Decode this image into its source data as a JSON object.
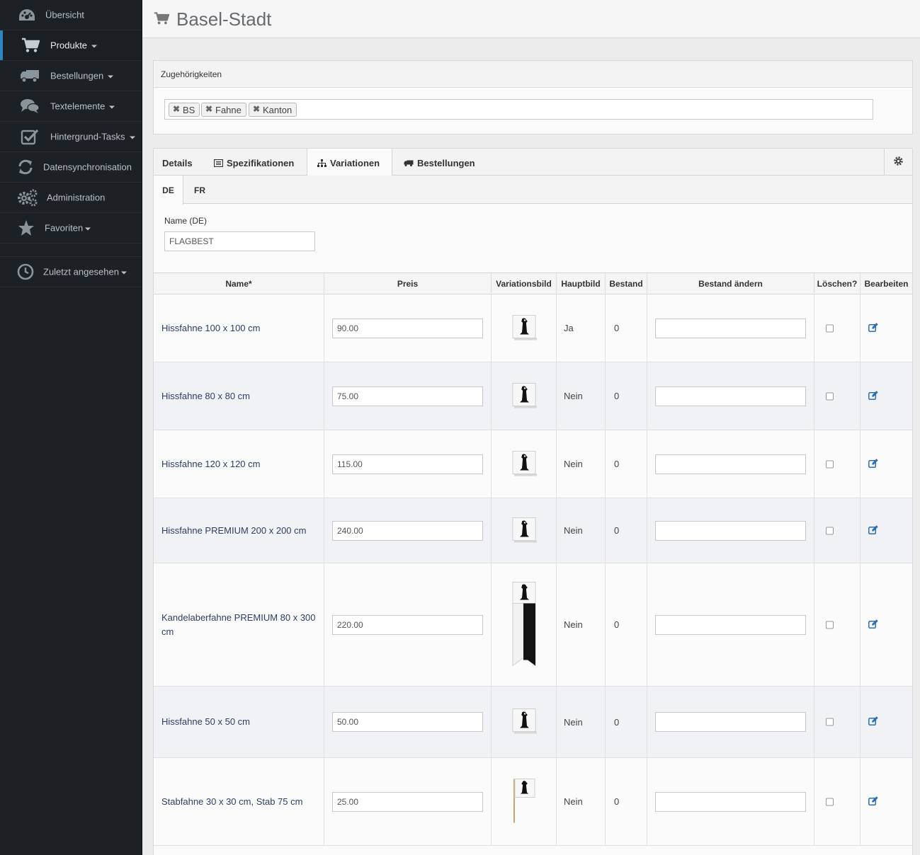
{
  "sidebar": {
    "items": [
      {
        "label": "Übersicht",
        "icon": "dashboard-icon",
        "caret": false
      },
      {
        "label": "Produkte",
        "icon": "shopping-cart-icon",
        "caret": true
      },
      {
        "label": "Bestellungen",
        "icon": "truck-icon",
        "caret": true
      },
      {
        "label": "Textelemente",
        "icon": "comments-icon",
        "caret": true
      },
      {
        "label": "Hintergrund-Tasks",
        "icon": "check-square-icon",
        "caret": true
      },
      {
        "label": "Datensynchronisation",
        "icon": "refresh-icon",
        "caret": false
      },
      {
        "label": "Administration",
        "icon": "cogs-icon",
        "caret": false
      },
      {
        "label": "Favoriten",
        "icon": "star-icon",
        "caret": true
      },
      {
        "label": "Zuletzt angesehen",
        "icon": "clock-icon",
        "caret": true
      }
    ]
  },
  "header": {
    "title": "Basel-Stadt",
    "icon": "shopping-cart-icon"
  },
  "zugehoerigkeiten": {
    "title": "Zugehörigkeiten",
    "tags": [
      "BS",
      "Fahne",
      "Kanton"
    ]
  },
  "tabs": {
    "items": [
      {
        "label": "Details",
        "icon": ""
      },
      {
        "label": "Spezifikationen",
        "icon": "list-alt-icon"
      },
      {
        "label": "Variationen",
        "icon": "sitemap-icon"
      },
      {
        "label": "Bestellungen",
        "icon": "truck-icon"
      }
    ],
    "active": "Variationen",
    "settings_icon": "gear-icon"
  },
  "lang_tabs": {
    "items": [
      "DE",
      "FR"
    ],
    "active": "DE"
  },
  "name_field": {
    "label": "Name (DE)",
    "value": "FLAGBEST"
  },
  "table": {
    "headers": [
      "Name*",
      "Preis",
      "Variationsbild",
      "Hauptbild",
      "Bestand",
      "Bestand ändern",
      "Löschen?",
      "Bearbeiten"
    ],
    "rows": [
      {
        "name": "Hissfahne 100 x 100 cm",
        "preis": "90.00",
        "hauptbild": "Ja",
        "bestand": "0",
        "image": "square-flag"
      },
      {
        "name": "Hissfahne 80 x 80 cm",
        "preis": "75.00",
        "hauptbild": "Nein",
        "bestand": "0",
        "image": "square-flag"
      },
      {
        "name": "Hissfahne 120 x 120 cm",
        "preis": "115.00",
        "hauptbild": "Nein",
        "bestand": "0",
        "image": "square-flag"
      },
      {
        "name": "Hissfahne PREMIUM 200 x 200 cm",
        "preis": "240.00",
        "hauptbild": "Nein",
        "bestand": "0",
        "image": "square-flag"
      },
      {
        "name": "Kandelaberfahne PREMIUM 80 x 300 cm",
        "preis": "220.00",
        "hauptbild": "Nein",
        "bestand": "0",
        "image": "banner-flag"
      },
      {
        "name": "Hissfahne 50 x 50 cm",
        "preis": "50.00",
        "hauptbild": "Nein",
        "bestand": "0",
        "image": "square-flag"
      },
      {
        "name": "Stabfahne 30 x 30 cm, Stab 75 cm",
        "preis": "25.00",
        "hauptbild": "Nein",
        "bestand": "0",
        "image": "stick-flag"
      }
    ]
  }
}
